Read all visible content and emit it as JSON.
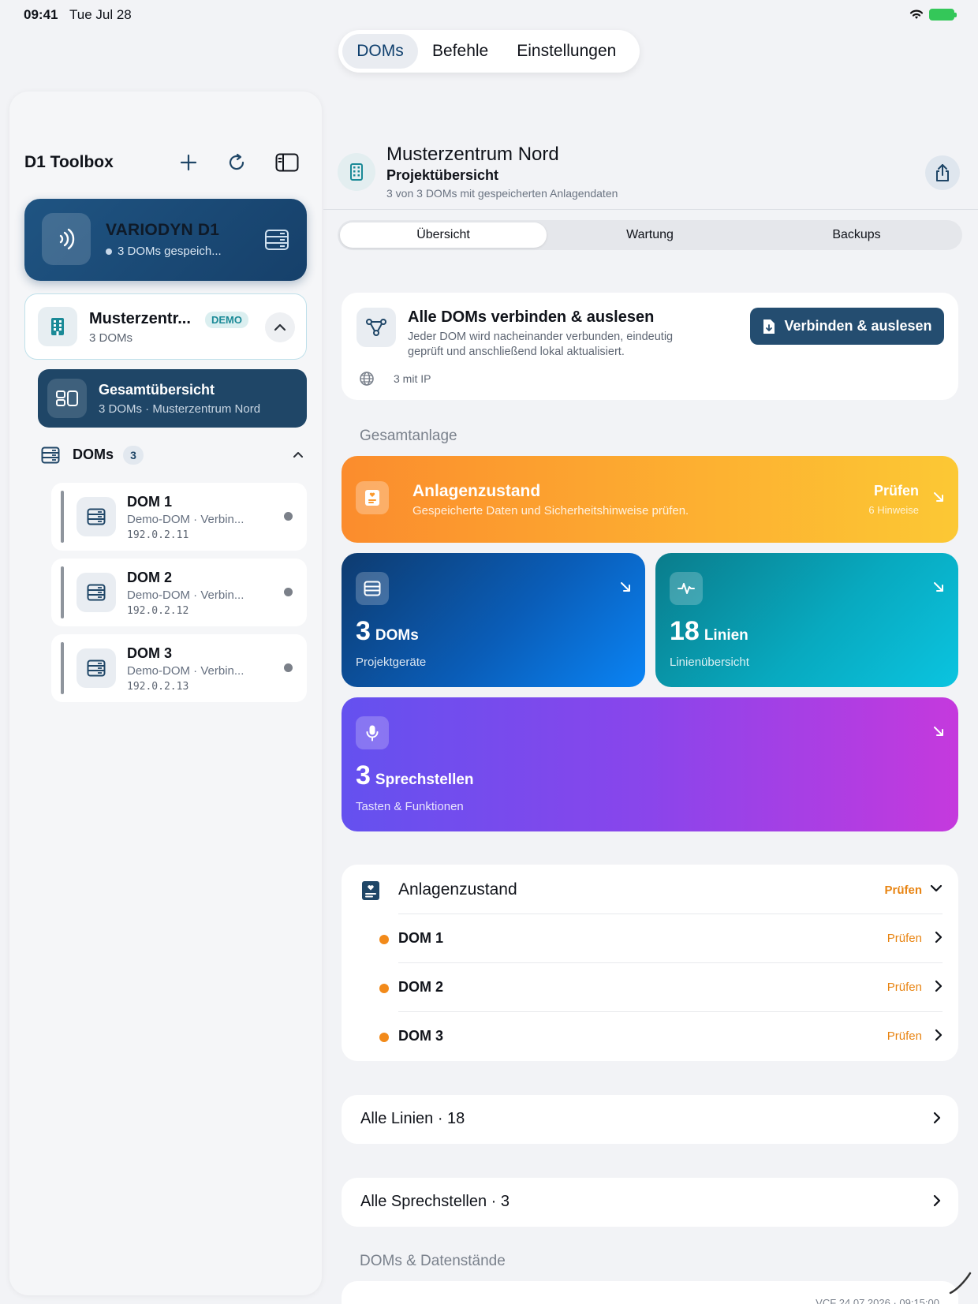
{
  "statusbar": {
    "time": "09:41",
    "date": "Tue Jul 28"
  },
  "top_tabs": [
    {
      "label": "DOMs",
      "active": true
    },
    {
      "label": "Befehle",
      "active": false
    },
    {
      "label": "Einstellungen",
      "active": false
    }
  ],
  "sidebar": {
    "title": "D1 Toolbox",
    "hero": {
      "title": "VARIODYN D1",
      "subtitle": "3 DOMs gespeich..."
    },
    "project": {
      "title": "Musterzentr...",
      "badge": "DEMO",
      "subtitle": "3 DOMs"
    },
    "overview": {
      "title": "Gesamtübersicht",
      "subtitle": "3 DOMs · Musterzentrum Nord"
    },
    "doms_section": {
      "label": "DOMs",
      "count": "3"
    },
    "doms": [
      {
        "name": "DOM 1",
        "subtitle": "Demo-DOM · Verbin...",
        "ip": "192.0.2.11"
      },
      {
        "name": "DOM 2",
        "subtitle": "Demo-DOM · Verbin...",
        "ip": "192.0.2.12"
      },
      {
        "name": "DOM 3",
        "subtitle": "Demo-DOM · Verbin...",
        "ip": "192.0.2.13"
      }
    ]
  },
  "main": {
    "title": "Musterzentrum Nord",
    "subtitle": "Projektübersicht",
    "subtitle2": "3 von 3 DOMs mit gespeicherten Anlagendaten",
    "tabs": [
      {
        "label": "Übersicht",
        "active": true
      },
      {
        "label": "Wartung",
        "active": false
      },
      {
        "label": "Backups",
        "active": false
      }
    ],
    "connect": {
      "title": "Alle DOMs verbinden & auslesen",
      "desc": "Jeder DOM wird nacheinander verbunden, eindeutig geprüft und anschließend lokal aktualisiert.",
      "button": "Verbinden & auslesen",
      "footer": "3 mit IP"
    },
    "section_gesamt": "Gesamtanlage",
    "state_tile": {
      "title": "Anlagenzustand",
      "subtitle": "Gespeicherte Daten und Sicherheitshinweise prüfen.",
      "action": "Prüfen",
      "hint": "6 Hinweise"
    },
    "tiles": [
      {
        "num": "3",
        "unit": "DOMs",
        "label": "Projektgeräte"
      },
      {
        "num": "18",
        "unit": "Linien",
        "label": "Linienübersicht"
      },
      {
        "num": "3",
        "unit": "Sprechstellen",
        "label": "Tasten & Funktionen"
      }
    ],
    "state_list": {
      "title": "Anlagenzustand",
      "action": "Prüfen",
      "rows": [
        {
          "name": "DOM 1",
          "action": "Prüfen"
        },
        {
          "name": "DOM 2",
          "action": "Prüfen"
        },
        {
          "name": "DOM 3",
          "action": "Prüfen"
        }
      ]
    },
    "link_lines": "Alle Linien · 18",
    "link_speakers": "Alle Sprechstellen · 3",
    "section_data": "DOMs & Datenstände",
    "bottom_meta": "VCF 24.07.2026 · 09:15:00"
  },
  "colors": {
    "accent_navy": "#1f4667",
    "orange": "#f28a1a",
    "blue": "#0a84f5",
    "teal": "#08a9bf",
    "purple": "#8a45eb"
  }
}
